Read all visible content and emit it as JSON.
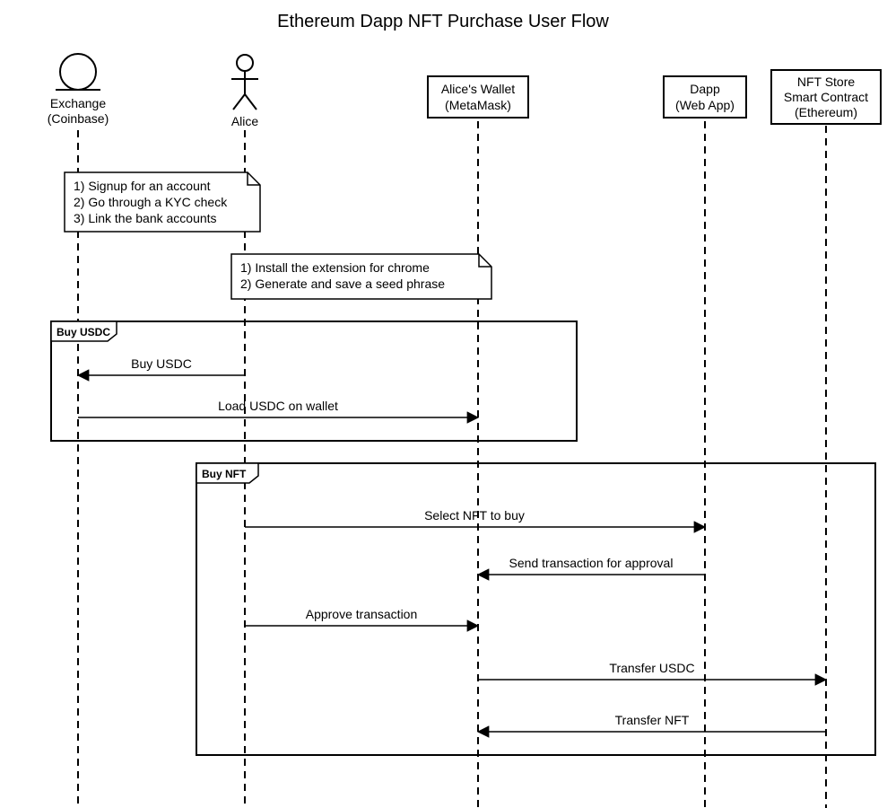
{
  "title": "Ethereum Dapp NFT Purchase User Flow",
  "participants": {
    "exchange": {
      "l1": "Exchange",
      "l2": "(Coinbase)"
    },
    "alice": {
      "l1": "Alice"
    },
    "wallet": {
      "l1": "Alice's Wallet",
      "l2": "(MetaMask)"
    },
    "dapp": {
      "l1": "Dapp",
      "l2": "(Web App)"
    },
    "contract": {
      "l1": "NFT Store",
      "l2": "Smart Contract",
      "l3": "(Ethereum)"
    }
  },
  "notes": {
    "signup": {
      "l1": "1) Signup for an account",
      "l2": "2) Go through a KYC check",
      "l3": "3) Link the bank accounts"
    },
    "install": {
      "l1": "1) Install the extension for chrome",
      "l2": "2) Generate and save a seed phrase"
    }
  },
  "fragments": {
    "buyUSDC": "Buy USDC",
    "buyNFT": "Buy NFT"
  },
  "messages": {
    "m1": "Buy USDC",
    "m2": "Load USDC on wallet",
    "m3": "Select NFT to buy",
    "m4": "Send transaction for approval",
    "m5": "Approve transaction",
    "m6": "Transfer USDC",
    "m7": "Transfer NFT"
  }
}
